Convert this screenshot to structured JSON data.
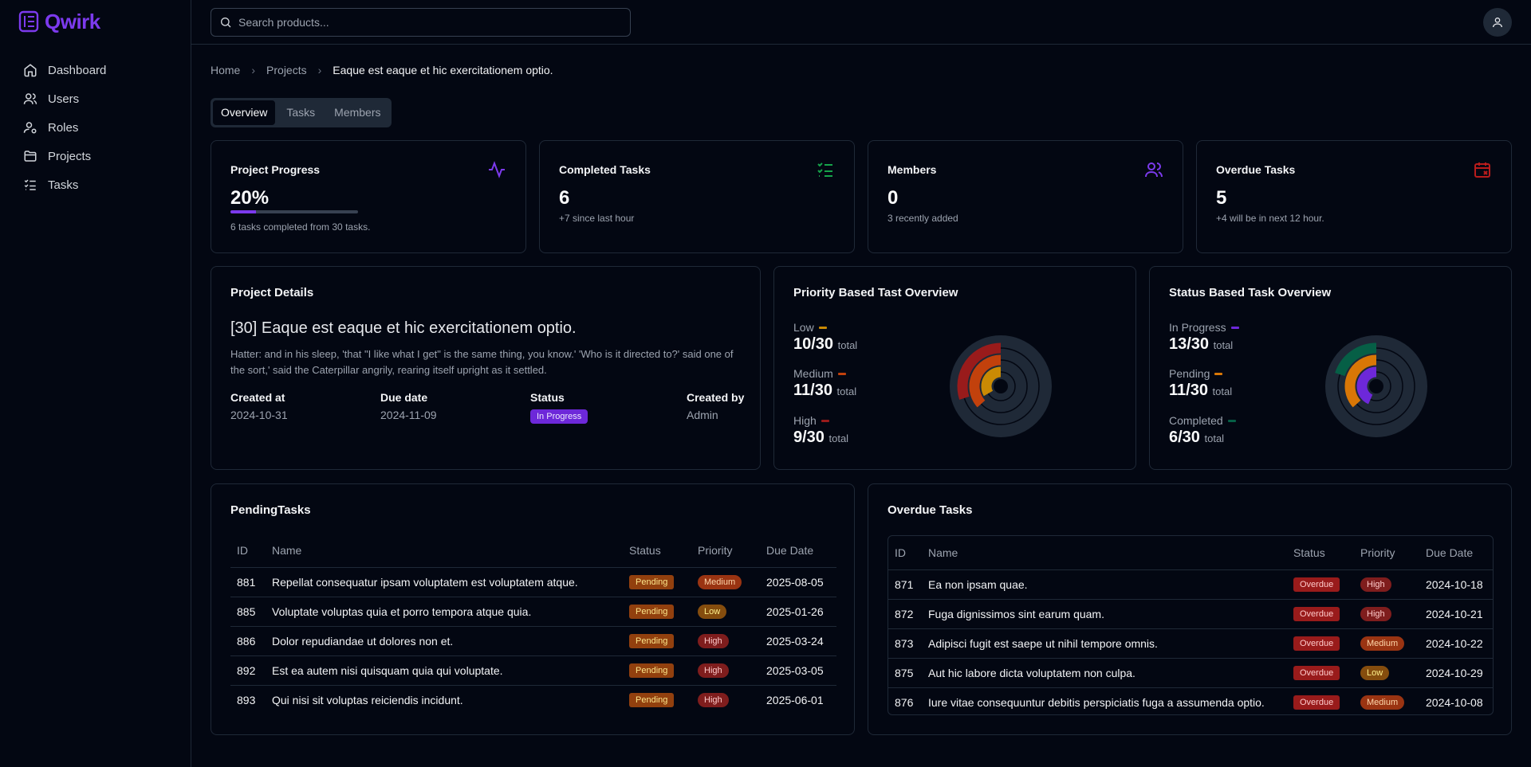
{
  "app": {
    "name": "Qwirk",
    "brand_color": "#7c3aed"
  },
  "sidebar": {
    "items": [
      {
        "label": "Dashboard",
        "icon": "home-icon"
      },
      {
        "label": "Users",
        "icon": "users-icon"
      },
      {
        "label": "Roles",
        "icon": "user-cog-icon"
      },
      {
        "label": "Projects",
        "icon": "folder-icon"
      },
      {
        "label": "Tasks",
        "icon": "list-checks-icon"
      }
    ]
  },
  "header": {
    "search_placeholder": "Search products..."
  },
  "breadcrumb": {
    "home": "Home",
    "projects": "Projects",
    "current": "Eaque est eaque et hic exercitationem optio."
  },
  "tabs": [
    {
      "label": "Overview",
      "active": true
    },
    {
      "label": "Tasks"
    },
    {
      "label": "Members"
    }
  ],
  "stats": {
    "progress": {
      "title": "Project Progress",
      "value": "20%",
      "fraction": 0.2,
      "sub": "6 tasks completed from 30 tasks.",
      "icon": "activity-icon"
    },
    "completed": {
      "title": "Completed Tasks",
      "value": "6",
      "sub": "+7 since last hour",
      "icon": "list-checks-icon"
    },
    "members": {
      "title": "Members",
      "value": "0",
      "sub": "3 recently added",
      "icon": "users-icon"
    },
    "overdue": {
      "title": "Overdue Tasks",
      "value": "5",
      "sub": "+4 will be in next 12 hour.",
      "icon": "calendar-x-icon"
    }
  },
  "project_details": {
    "title": "Project Details",
    "heading": "[30] Eaque est eaque et hic exercitationem optio.",
    "description": "Hatter: and in his sleep, 'that \"I like what I get\" is the same thing, you know.' 'Who is it directed to?' said one of the sort,' said the Caterpillar angrily, rearing itself upright as it settled.",
    "created_at_label": "Created at",
    "created_at": "2024-10-31",
    "due_date_label": "Due date",
    "due_date": "2024-11-09",
    "status_label": "Status",
    "status": "In Progress",
    "created_by_label": "Created by",
    "created_by": "Admin"
  },
  "priority_overview": {
    "title": "Priority Based Tast Overview",
    "items": [
      {
        "label": "Low",
        "value": "10/30",
        "fraction": 0.3333,
        "color": "#ca8a04"
      },
      {
        "label": "Medium",
        "value": "11/30",
        "fraction": 0.3667,
        "color": "#c2410c"
      },
      {
        "label": "High",
        "value": "9/30",
        "fraction": 0.3,
        "color": "#991b1b"
      }
    ],
    "total_label": "total"
  },
  "status_overview": {
    "title": "Status Based Task Overview",
    "items": [
      {
        "label": "In Progress",
        "value": "13/30",
        "fraction": 0.4333,
        "color": "#6d28d9"
      },
      {
        "label": "Pending",
        "value": "11/30",
        "fraction": 0.3667,
        "color": "#d97706"
      },
      {
        "label": "Completed",
        "value": "6/30",
        "fraction": 0.2,
        "color": "#065f46"
      }
    ],
    "total_label": "total"
  },
  "pending_tasks": {
    "title": "PendingTasks",
    "columns": [
      "ID",
      "Name",
      "Status",
      "Priority",
      "Due Date"
    ],
    "rows": [
      {
        "id": "881",
        "name": "Repellat consequatur ipsam voluptatem est voluptatem atque.",
        "status": "Pending",
        "priority": "Medium",
        "due": "2025-08-05"
      },
      {
        "id": "885",
        "name": "Voluptate voluptas quia et porro tempora atque quia.",
        "status": "Pending",
        "priority": "Low",
        "due": "2025-01-26"
      },
      {
        "id": "886",
        "name": "Dolor repudiandae ut dolores non et.",
        "status": "Pending",
        "priority": "High",
        "due": "2025-03-24"
      },
      {
        "id": "892",
        "name": "Est ea autem nisi quisquam quia qui voluptate.",
        "status": "Pending",
        "priority": "High",
        "due": "2025-03-05"
      },
      {
        "id": "893",
        "name": "Qui nisi sit voluptas reiciendis incidunt.",
        "status": "Pending",
        "priority": "High",
        "due": "2025-06-01"
      }
    ]
  },
  "overdue_tasks": {
    "title": "Overdue Tasks",
    "columns": [
      "ID",
      "Name",
      "Status",
      "Priority",
      "Due Date"
    ],
    "rows": [
      {
        "id": "871",
        "name": "Ea non ipsam quae.",
        "status": "Overdue",
        "priority": "High",
        "due": "2024-10-18"
      },
      {
        "id": "872",
        "name": "Fuga dignissimos sint earum quam.",
        "status": "Overdue",
        "priority": "High",
        "due": "2024-10-21"
      },
      {
        "id": "873",
        "name": "Adipisci fugit est saepe ut nihil tempore omnis.",
        "status": "Overdue",
        "priority": "Medium",
        "due": "2024-10-22"
      },
      {
        "id": "875",
        "name": "Aut hic labore dicta voluptatem non culpa.",
        "status": "Overdue",
        "priority": "Low",
        "due": "2024-10-29"
      },
      {
        "id": "876",
        "name": "Iure vitae consequuntur debitis perspiciatis fuga a assumenda optio.",
        "status": "Overdue",
        "priority": "Medium",
        "due": "2024-10-08"
      }
    ]
  }
}
